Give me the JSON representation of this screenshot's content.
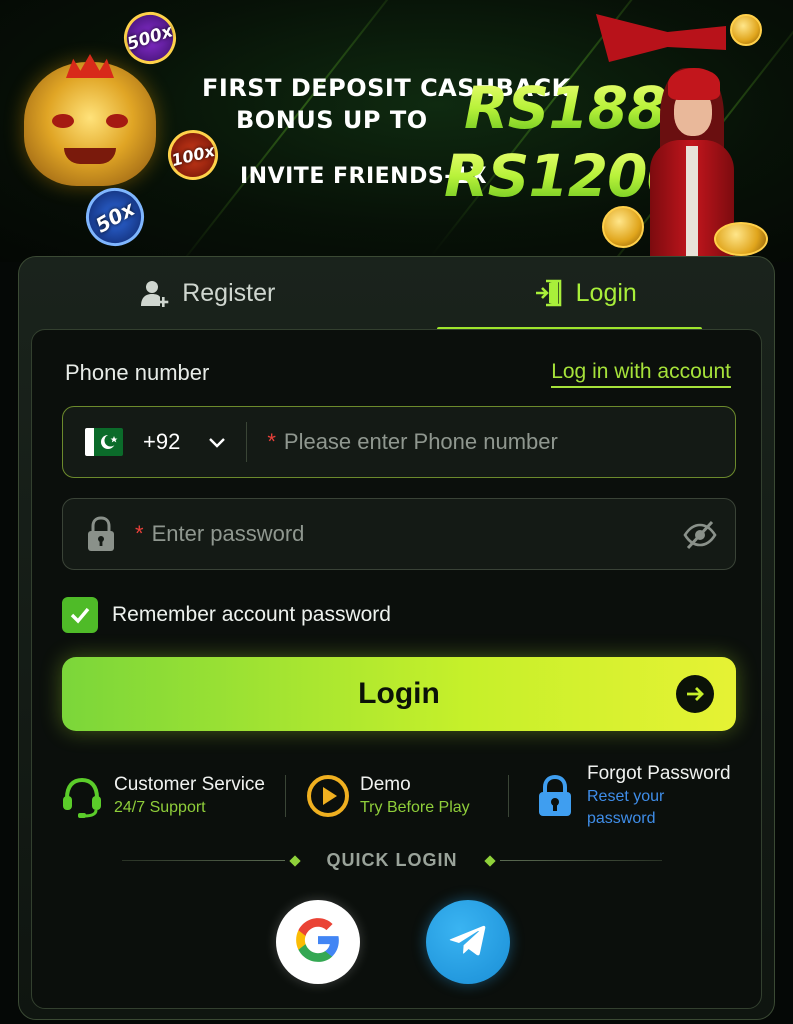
{
  "banner": {
    "line1": "FIRST DEPOSIT CASHBACK",
    "line2": "BONUS UP TO",
    "amount1": "RS188",
    "line3": "INVITE FRIENDS-1X",
    "amount2": "RS1200",
    "chips": [
      "500x",
      "100x",
      "50x"
    ]
  },
  "tabs": [
    {
      "label": "Register",
      "icon": "add-user-icon",
      "active": false
    },
    {
      "label": "Login",
      "icon": "login-door-icon",
      "active": true
    }
  ],
  "form": {
    "phone_label": "Phone number",
    "account_link": "Log in with account",
    "country_flag": "pakistan-flag-icon",
    "country_code": "+92",
    "required_mark": "*",
    "phone_placeholder": "Please enter Phone number",
    "password_placeholder": "Enter password",
    "remember_label": "Remember account password",
    "remember_checked": true,
    "login_button": "Login"
  },
  "links": [
    {
      "title": "Customer Service",
      "subtitle": "24/7 Support",
      "icon": "headset-icon"
    },
    {
      "title": "Demo",
      "subtitle": "Try Before Play",
      "icon": "play-icon"
    },
    {
      "title": "Forgot Password",
      "subtitle": "Reset your password",
      "icon": "lock-icon"
    }
  ],
  "quick_login": {
    "label": "QUICK LOGIN",
    "providers": [
      "google",
      "telegram"
    ]
  },
  "colors": {
    "accent": "#a8ef3a",
    "background": "#0b0f0c",
    "required": "#e8403a",
    "link_blue": "#3f8de8"
  }
}
